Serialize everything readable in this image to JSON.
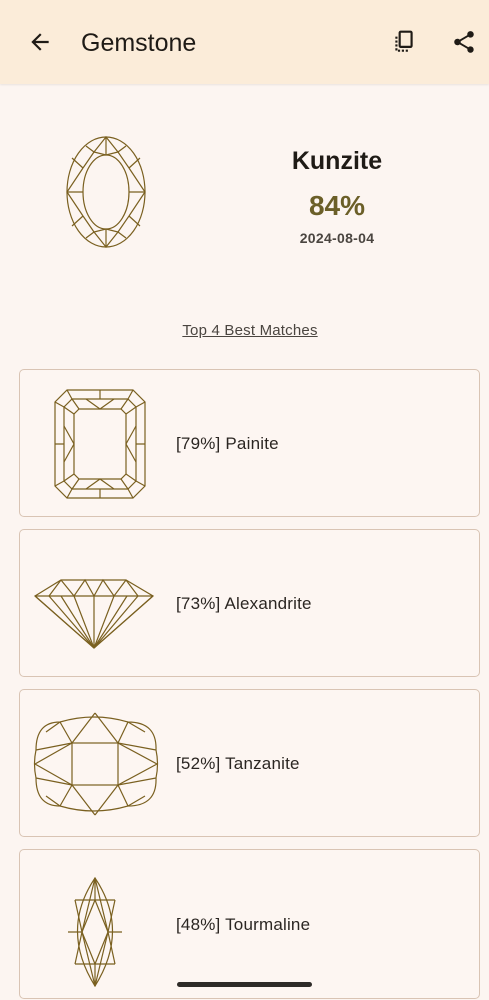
{
  "app_bar": {
    "title": "Gemstone",
    "back_icon": "arrow-back-icon",
    "compare_icon": "compare-icon",
    "share_icon": "share-icon"
  },
  "result": {
    "name": "Kunzite",
    "confidence": "84%",
    "date": "2024-08-04",
    "cut_icon": "oval-cut-icon"
  },
  "matches_heading": "Top 4 Best Matches",
  "matches": [
    {
      "label": "[79%] Painite",
      "cut_icon": "emerald-cut-icon"
    },
    {
      "label": "[73%] Alexandrite",
      "cut_icon": "brilliant-side-icon"
    },
    {
      "label": "[52%] Tanzanite",
      "cut_icon": "cushion-cut-icon"
    },
    {
      "label": "[48%] Tourmaline",
      "cut_icon": "marquise-cut-icon"
    }
  ],
  "colors": {
    "background": "#fcf5f1",
    "app_bar": "#fbecd9",
    "accent": "#6b5f28",
    "gem_line": "#7a6020",
    "card_border": "#d9c4b4"
  }
}
